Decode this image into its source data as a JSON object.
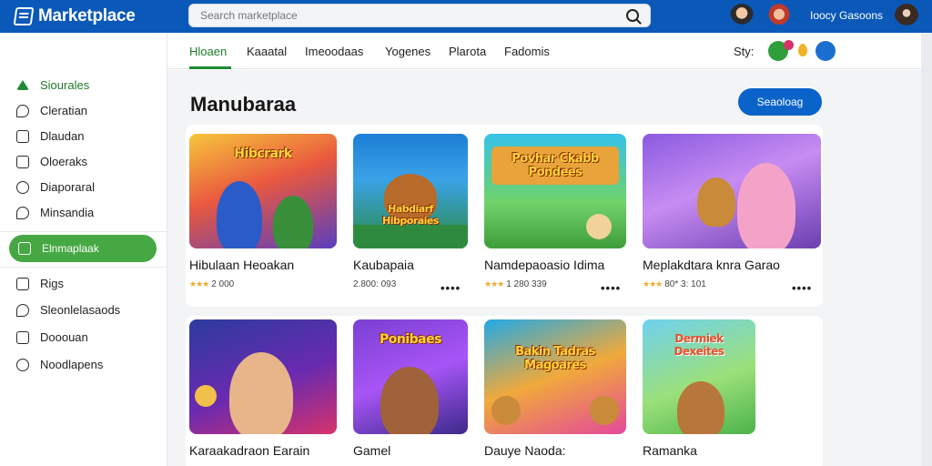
{
  "app": {
    "title": "Marketplace",
    "search_placeholder": "Search marketplace",
    "user_name": "Ioocy Gasoons"
  },
  "colors": {
    "topbar": "#0a59b8",
    "accent_green": "#46a843",
    "button_blue": "#0a63c9"
  },
  "sidebar": {
    "items": [
      {
        "label": "Siourales",
        "icon": "triangle-icon"
      },
      {
        "label": "Cleratian",
        "icon": "chat-icon"
      },
      {
        "label": "Dlaudan",
        "icon": "document-icon"
      },
      {
        "label": "Oloeraks",
        "icon": "box-icon"
      },
      {
        "label": "Diaporaral",
        "icon": "user-icon"
      },
      {
        "label": "Minsandia",
        "icon": "message-icon"
      }
    ],
    "active_item": {
      "label": "Elnmaplaak",
      "icon": "grid-icon"
    },
    "lower_items": [
      {
        "label": "Rigs",
        "icon": "list-icon"
      },
      {
        "label": "Sleonlelasaods",
        "icon": "comment-icon"
      },
      {
        "label": "Dooouan",
        "icon": "mail-icon"
      },
      {
        "label": "Noodlapens",
        "icon": "badge-icon"
      }
    ]
  },
  "tabs": [
    {
      "label": "Hloaen",
      "active": true
    },
    {
      "label": "Kaaatal"
    },
    {
      "label": "Imeoodaas"
    },
    {
      "label": "Yogenes"
    },
    {
      "label": "Plarota"
    },
    {
      "label": "Fadomis"
    }
  ],
  "tab_extra": "Sty:",
  "main": {
    "title": "Manubaraa",
    "cta_label": "Seaoloag"
  },
  "cards": [
    {
      "title": "Hibulaan Heoakan",
      "stars": "★★★",
      "meta": "2 000",
      "banner": "Hibcrark"
    },
    {
      "title": "Kaubapaia",
      "stars": "",
      "meta": "2.800: 093",
      "banner": "Habdiarf Hibporaies"
    },
    {
      "title": "Namdepaoasio Idima",
      "stars": "★★★",
      "meta": "1 280 339",
      "banner": "Povhar Ckabb Pondees"
    },
    {
      "title": "Meplakdtara knra Garao",
      "stars": "★★★",
      "meta": "80* 3: 101",
      "banner": ""
    },
    {
      "title": "Karaakadraon Earain",
      "stars": "",
      "meta": "",
      "banner": ""
    },
    {
      "title": "Gamel",
      "stars": "",
      "meta": "",
      "banner": "Ponibaes"
    },
    {
      "title": "Dauye Naoda:",
      "stars": "",
      "meta": "",
      "banner": "Bakin Tadras Magoares"
    },
    {
      "title": "Ramanka",
      "stars": "",
      "meta": "",
      "banner": "Dermiek Dexeites"
    }
  ],
  "more_label": "••••"
}
